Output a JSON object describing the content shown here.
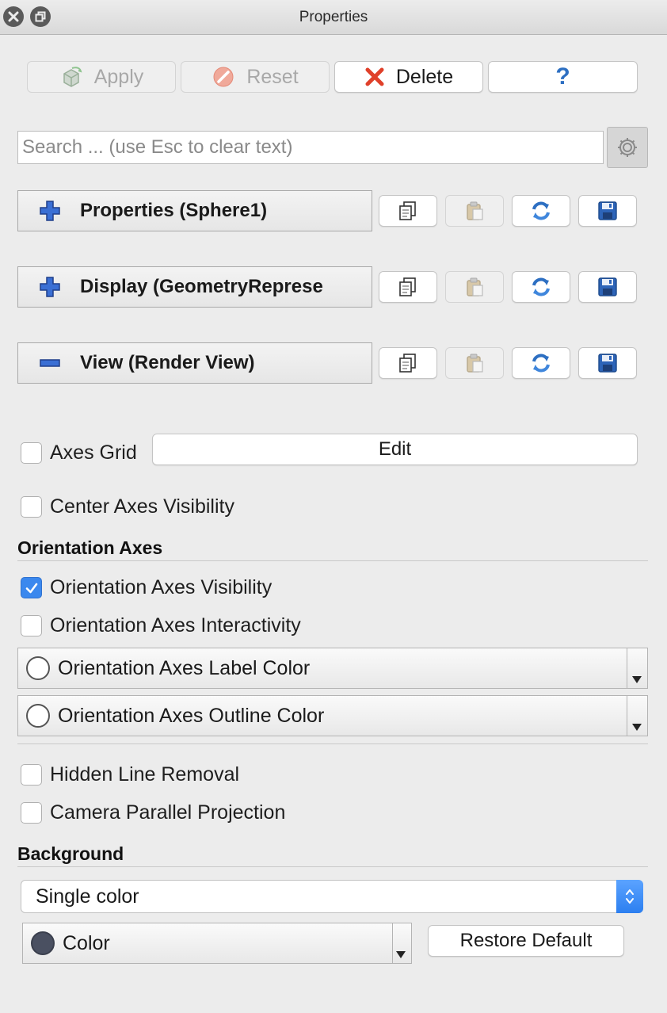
{
  "window": {
    "title": "Properties"
  },
  "toolbar": {
    "apply_label": "Apply",
    "reset_label": "Reset",
    "delete_label": "Delete",
    "help_label": "?"
  },
  "search": {
    "placeholder": "Search ... (use Esc to clear text)"
  },
  "sections": [
    {
      "label": "Properties (Sphere1)",
      "state": "collapsed"
    },
    {
      "label": "Display (GeometryReprese",
      "state": "collapsed"
    },
    {
      "label": "View (Render View)",
      "state": "expanded"
    }
  ],
  "view": {
    "axes_grid": {
      "label": "Axes Grid",
      "checked": false,
      "edit_label": "Edit"
    },
    "center_axes_visibility": {
      "label": "Center Axes Visibility",
      "checked": false
    },
    "orientation_axes": {
      "title": "Orientation Axes",
      "visibility": {
        "label": "Orientation Axes Visibility",
        "checked": true
      },
      "interactivity": {
        "label": "Orientation Axes Interactivity",
        "checked": false
      },
      "label_color": {
        "label": "Orientation Axes Label Color",
        "swatch": "#ffffff"
      },
      "outline_color": {
        "label": "Orientation Axes Outline Color",
        "swatch": "#ffffff"
      }
    },
    "hidden_line_removal": {
      "label": "Hidden Line Removal",
      "checked": false
    },
    "camera_parallel_projection": {
      "label": "Camera Parallel Projection",
      "checked": false
    },
    "background": {
      "title": "Background",
      "mode": "Single color",
      "color_label": "Color",
      "color_swatch": "#4a5061",
      "restore_label": "Restore Default"
    }
  },
  "colors": {
    "accent": "#3b88ee",
    "delete_red": "#e0402a",
    "icon_blue": "#2d6fc2"
  }
}
